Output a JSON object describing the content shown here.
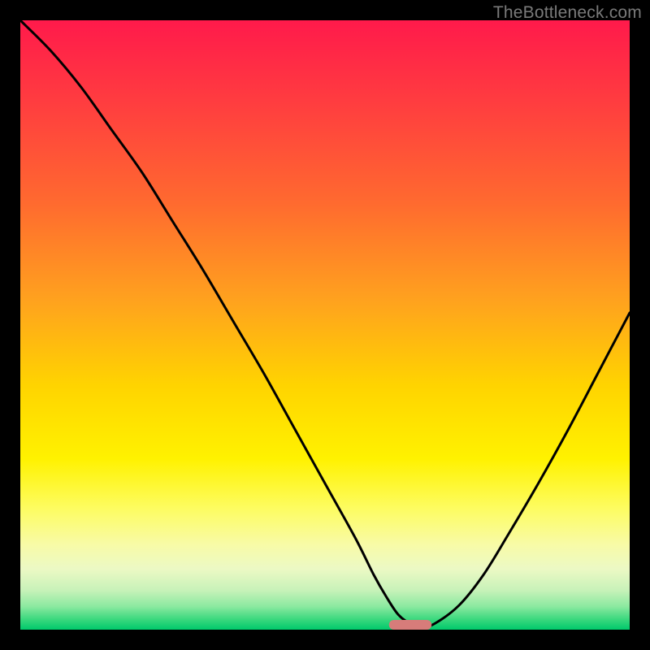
{
  "watermark": "TheBottleneck.com",
  "chart_data": {
    "type": "line",
    "title": "",
    "xlabel": "",
    "ylabel": "",
    "xlim": [
      0,
      100
    ],
    "ylim": [
      0,
      100
    ],
    "series": [
      {
        "name": "curve",
        "color": "#000000",
        "x": [
          0,
          5,
          10,
          15,
          20,
          25,
          30,
          35,
          40,
          45,
          50,
          55,
          58,
          60,
          62,
          64,
          66,
          68,
          72,
          76,
          80,
          85,
          90,
          95,
          100
        ],
        "y": [
          100,
          95,
          89,
          82,
          75,
          67,
          59,
          50.5,
          42,
          33,
          24,
          15,
          9,
          5.5,
          2.5,
          1,
          0.5,
          1,
          4,
          9,
          15.5,
          24,
          33,
          42.5,
          52
        ]
      }
    ],
    "marker": {
      "name": "optimum-marker",
      "x_center": 64,
      "width_pct": 7,
      "color": "#d77c7a"
    },
    "gradient_stops": [
      {
        "offset": 0.0,
        "color": "#ff1a4b"
      },
      {
        "offset": 0.14,
        "color": "#ff3e3f"
      },
      {
        "offset": 0.3,
        "color": "#ff6a2f"
      },
      {
        "offset": 0.46,
        "color": "#ffa21e"
      },
      {
        "offset": 0.6,
        "color": "#ffd400"
      },
      {
        "offset": 0.72,
        "color": "#fff200"
      },
      {
        "offset": 0.8,
        "color": "#fdfc60"
      },
      {
        "offset": 0.86,
        "color": "#f8fba6"
      },
      {
        "offset": 0.9,
        "color": "#ecf9c4"
      },
      {
        "offset": 0.935,
        "color": "#c8f2b9"
      },
      {
        "offset": 0.962,
        "color": "#8be9a0"
      },
      {
        "offset": 0.982,
        "color": "#3ed97f"
      },
      {
        "offset": 1.0,
        "color": "#00c96b"
      }
    ]
  }
}
